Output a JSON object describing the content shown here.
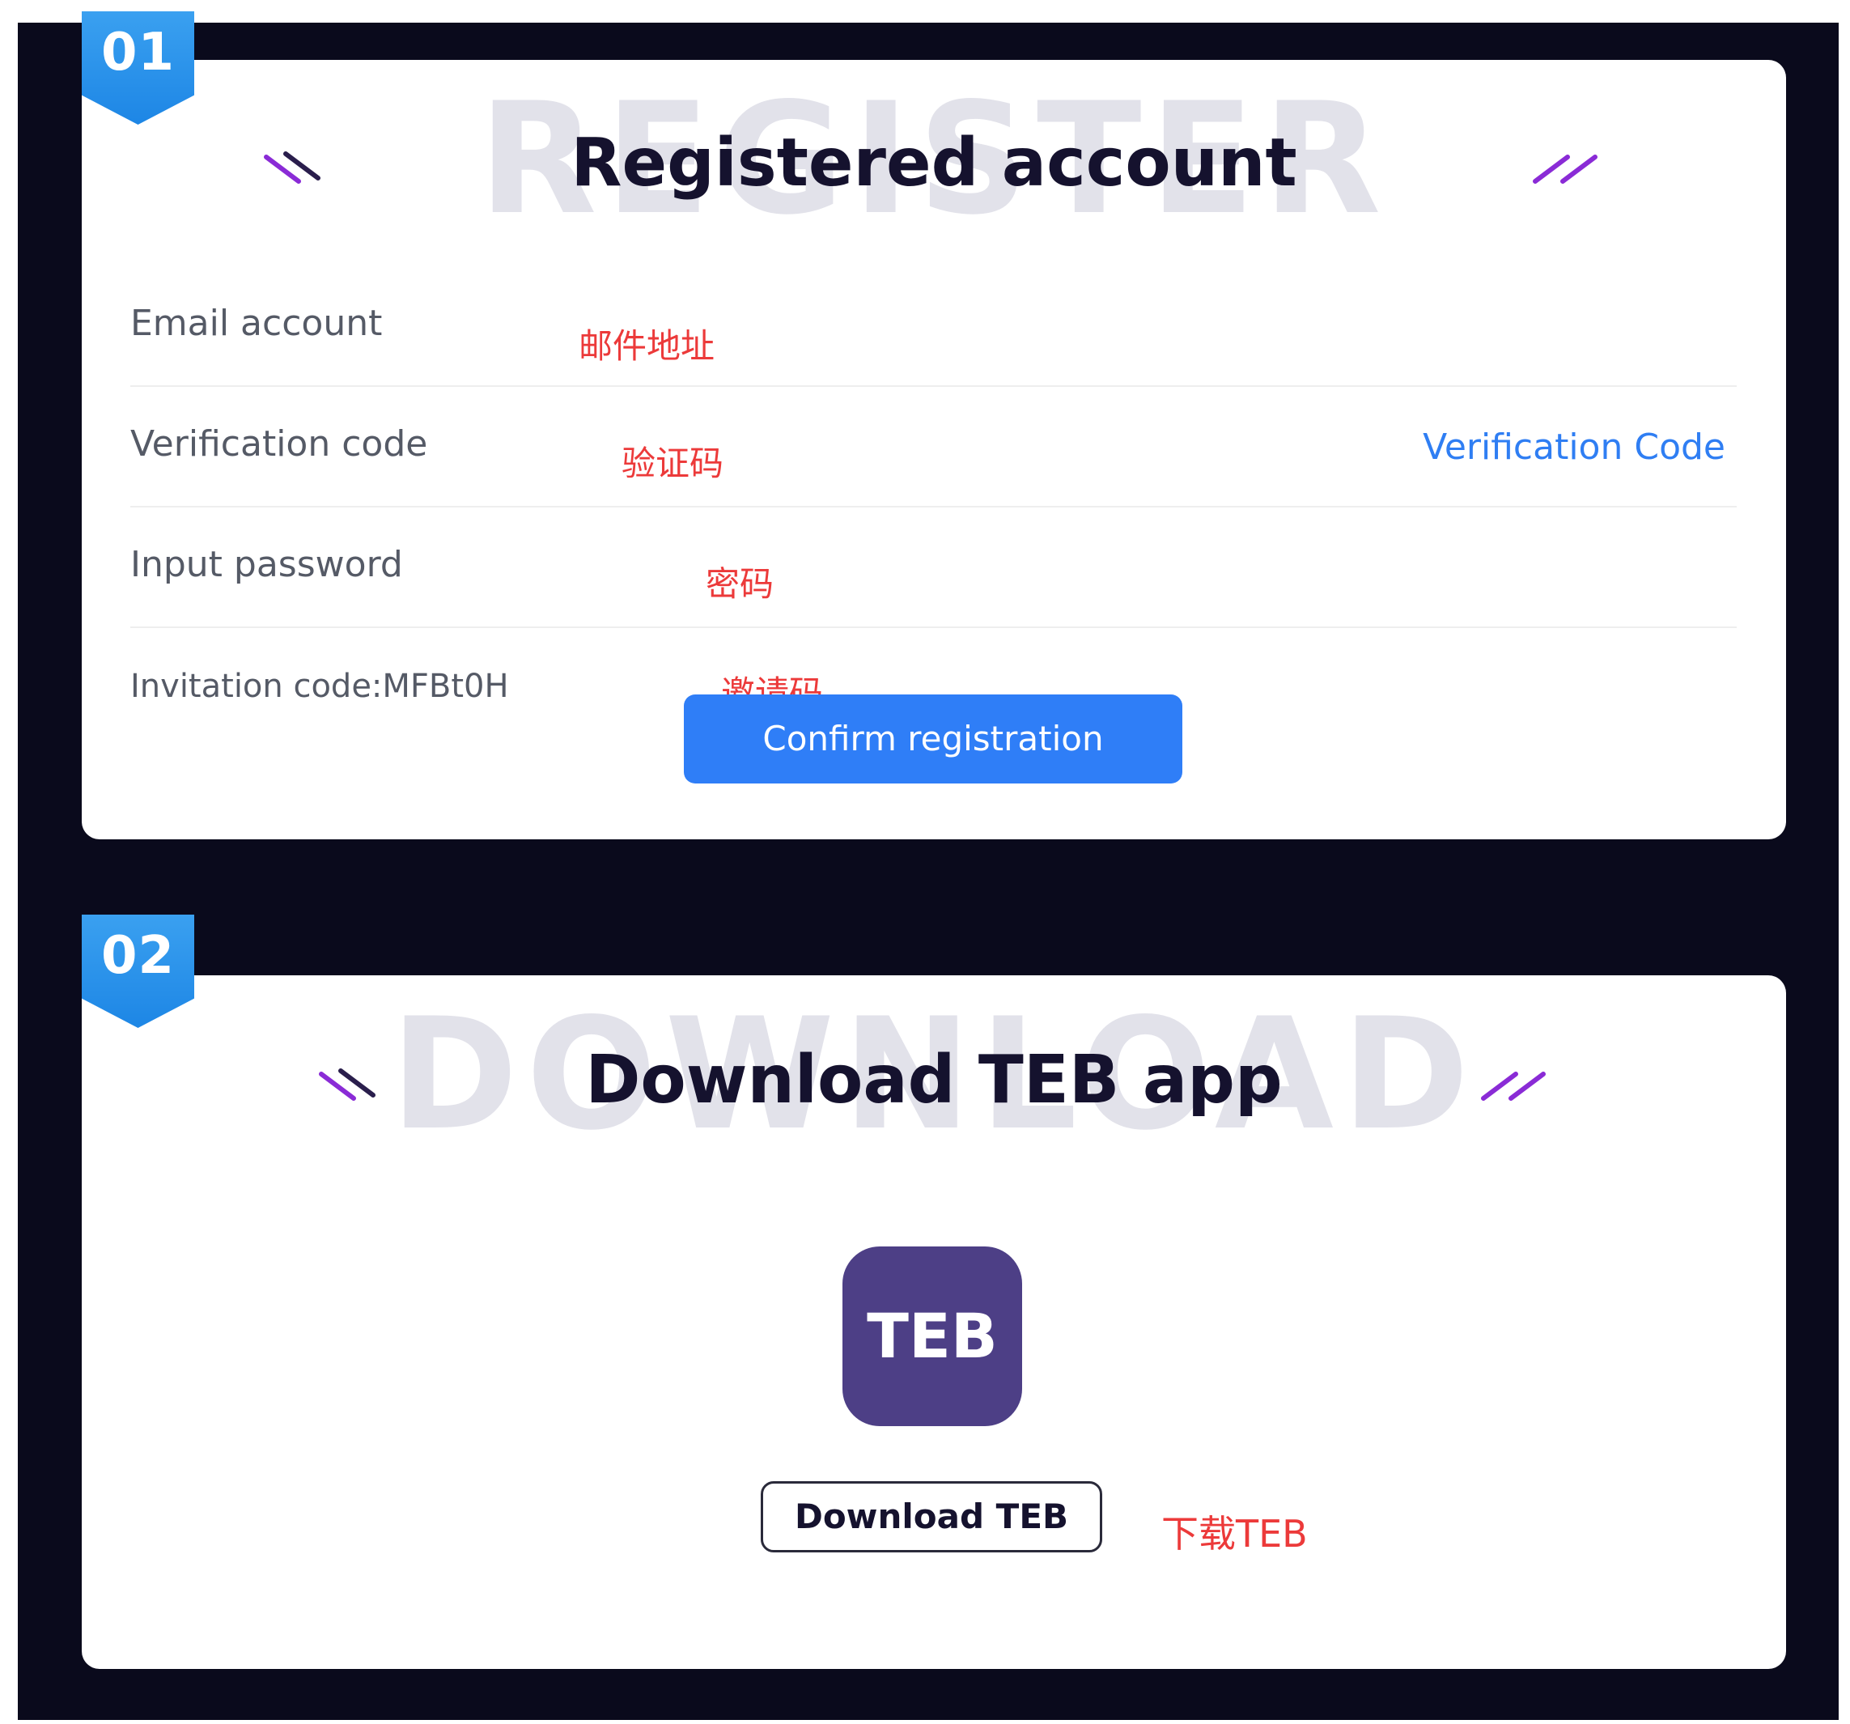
{
  "register": {
    "badge": "01",
    "watermark": "REGISTER",
    "title": "Registered account",
    "fields": [
      {
        "label": "Email account",
        "annotation": "邮件地址"
      },
      {
        "label": "Verification code",
        "annotation": "验证码",
        "action": "Verification Code"
      },
      {
        "label": "Input password",
        "annotation": "密码"
      },
      {
        "label": "Invitation code:MFBt0H",
        "annotation": "邀请码"
      }
    ],
    "confirm_label": "Confirm registration"
  },
  "download": {
    "badge": "02",
    "watermark": "DOWNLOAD",
    "title": "Download TEB app",
    "app_icon_text": "TEB",
    "download_label": "Download TEB",
    "annotation": "下载TEB"
  },
  "colors": {
    "frame_bg": "#0a0a1c",
    "badge_blue": "#2a93ea",
    "primary_button": "#2f7ef7",
    "link_blue": "#2f7ef3",
    "annotation_red": "#ec3a3a",
    "app_icon_bg": "#4d3f86",
    "slash_purple": "#8a2bd6"
  }
}
